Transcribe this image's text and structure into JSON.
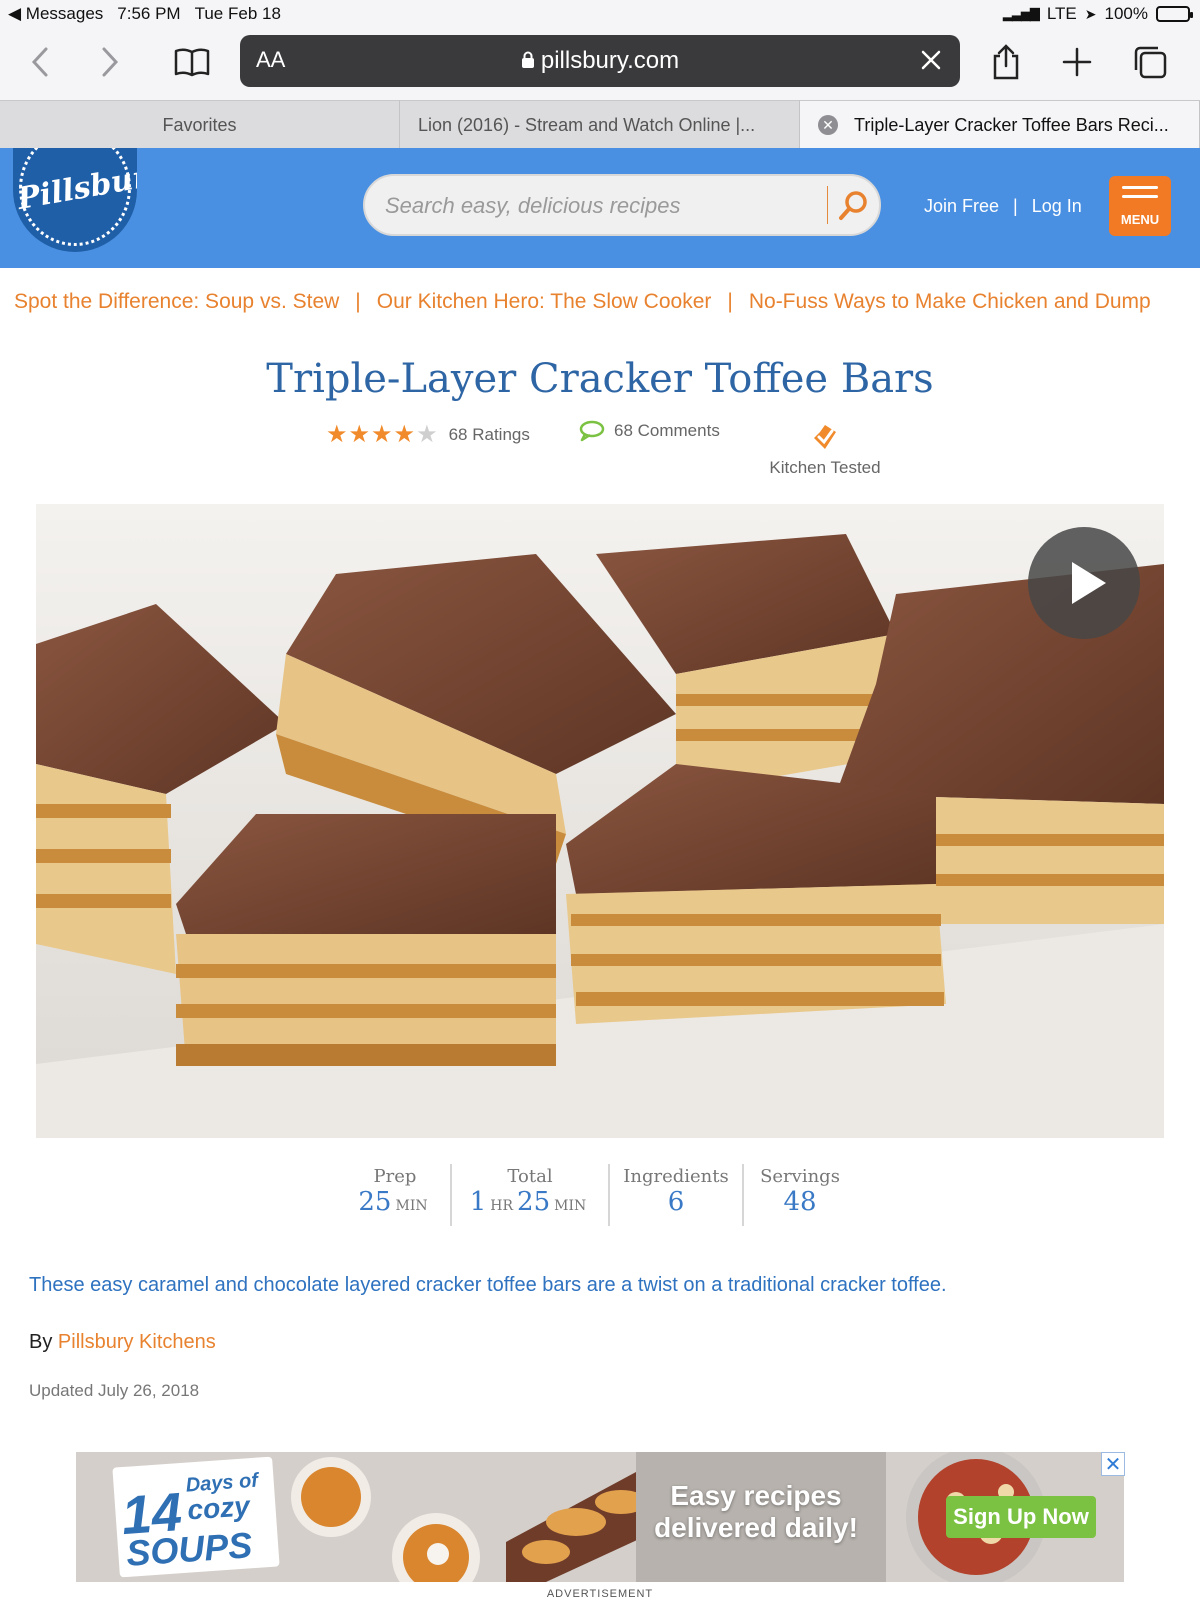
{
  "status_bar": {
    "back_app": "Messages",
    "time": "7:56 PM",
    "date": "Tue Feb 18",
    "network": "LTE",
    "battery": "100%",
    "battery_color": "#34c759"
  },
  "browser": {
    "text_size_label": "AA",
    "url": "pillsbury.com",
    "icons": [
      "back-icon",
      "forward-icon",
      "bookmarks-icon",
      "lock-icon",
      "clear-icon",
      "share-icon",
      "new-tab-icon",
      "tabs-icon"
    ],
    "tabs": [
      {
        "label": "Favorites"
      },
      {
        "label": "Lion (2016) - Stream and Watch Online |..."
      },
      {
        "label": "Triple-Layer Cracker Toffee Bars Reci..."
      }
    ]
  },
  "site": {
    "logo_text": "Pillsbury",
    "search_placeholder": "Search easy, delicious recipes",
    "join_label": "Join Free",
    "auth_separator": "|",
    "login_label": "Log In",
    "menu_label": "MENU",
    "brand_blue": "#4a90e2",
    "accent_orange": "#f27a24"
  },
  "topics": {
    "items": [
      "Spot the Difference: Soup vs. Stew",
      "Our Kitchen Hero: The Slow Cooker",
      "No-Fuss Ways to Make Chicken and Dump"
    ],
    "separator": "|"
  },
  "recipe": {
    "title": "Triple-Layer Cracker Toffee Bars",
    "rating_value": 4,
    "rating_max": 5,
    "ratings_label": "68 Ratings",
    "comments_label": "68 Comments",
    "kitchen_tested_label": "Kitchen Tested",
    "stats": {
      "prep": {
        "label": "Prep",
        "value": "25",
        "unit": "MIN"
      },
      "total": {
        "label": "Total",
        "hours": "1",
        "hours_unit": "HR",
        "minutes": "25",
        "minutes_unit": "MIN"
      },
      "ingredients": {
        "label": "Ingredients",
        "value": "6"
      },
      "servings": {
        "label": "Servings",
        "value": "48"
      }
    },
    "description": "These easy caramel and chocolate layered cracker toffee bars are a twist on a traditional cracker toffee.",
    "by_prefix": "By",
    "author": "Pillsbury Kitchens",
    "updated": "Updated July 26, 2018"
  },
  "ad": {
    "badge_number": "14",
    "badge_line1": "Days of",
    "badge_line2": "cozy",
    "badge_line3": "SOUPS",
    "headline": "Easy recipes delivered daily!",
    "cta": "Sign Up Now",
    "label": "ADVERTISEMENT",
    "cta_color": "#7cc242"
  }
}
